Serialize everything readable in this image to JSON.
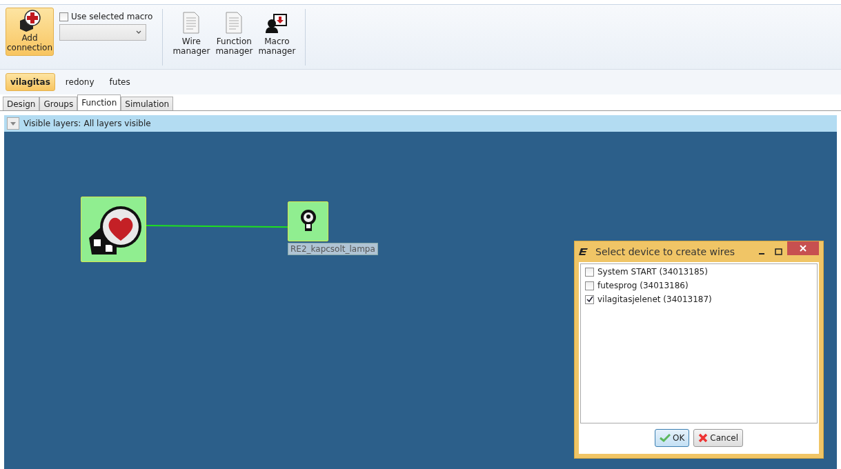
{
  "ribbon": {
    "add_connection": {
      "label": "Add connection",
      "selected": true
    },
    "use_selected_macro": {
      "label": "Use selected macro",
      "checked": false
    },
    "managers": [
      {
        "label": "Wire manager",
        "kind": "document"
      },
      {
        "label": "Function manager",
        "kind": "document"
      },
      {
        "label": "Macro manager",
        "kind": "macro"
      }
    ]
  },
  "document_tabs": [
    {
      "label": "vilagitas",
      "selected": true
    },
    {
      "label": "redony",
      "selected": false
    },
    {
      "label": "futes",
      "selected": false
    }
  ],
  "view_tabs": [
    {
      "label": "Design",
      "selected": false
    },
    {
      "label": "Groups",
      "selected": false
    },
    {
      "label": "Function",
      "selected": true
    },
    {
      "label": "Simulation",
      "selected": false
    }
  ],
  "layers_bar": {
    "label": "Visible layers:",
    "value": "All layers visible"
  },
  "canvas": {
    "nodes": [
      {
        "kind": "scene"
      },
      {
        "kind": "lamp",
        "label": "RE2_kapcsolt_lampa"
      }
    ]
  },
  "dialog": {
    "title": "Select device to create wires",
    "items": [
      {
        "label": "System START (34013185)",
        "checked": false
      },
      {
        "label": "futesprog (34013186)",
        "checked": false
      },
      {
        "label": "vilagitasjelenet (34013187)",
        "checked": true
      }
    ],
    "buttons": [
      {
        "label": "OK",
        "kind": "ok"
      },
      {
        "label": "Cancel",
        "kind": "cancel"
      }
    ]
  }
}
